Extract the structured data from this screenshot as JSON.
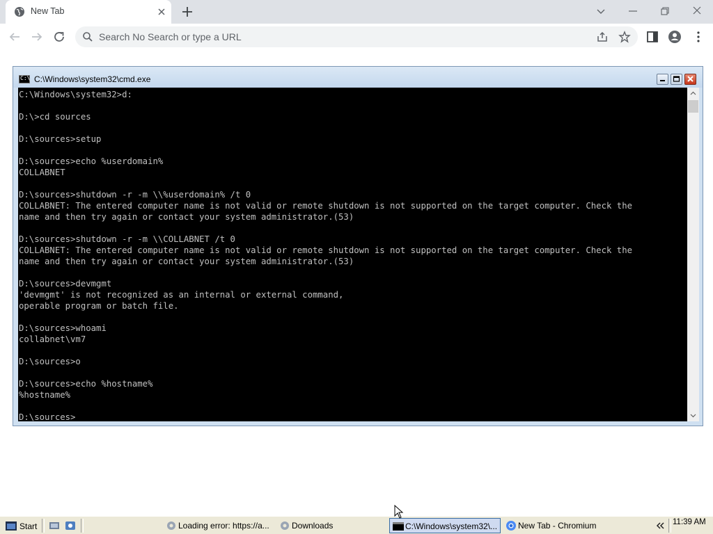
{
  "browser": {
    "tab": {
      "title": "New Tab"
    },
    "omnibox": {
      "placeholder": "Search No Search or type a URL"
    }
  },
  "cmd": {
    "title": "C:\\Windows\\system32\\cmd.exe",
    "lines": [
      "C:\\Windows\\system32>d:",
      "",
      "D:\\>cd sources",
      "",
      "D:\\sources>setup",
      "",
      "D:\\sources>echo %userdomain%",
      "COLLABNET",
      "",
      "D:\\sources>shutdown -r -m \\\\%userdomain% /t 0",
      "COLLABNET: The entered computer name is not valid or remote shutdown is not supported on the target computer. Check the",
      "name and then try again or contact your system administrator.(53)",
      "",
      "D:\\sources>shutdown -r -m \\\\COLLABNET /t 0",
      "COLLABNET: The entered computer name is not valid or remote shutdown is not supported on the target computer. Check the",
      "name and then try again or contact your system administrator.(53)",
      "",
      "D:\\sources>devmgmt",
      "'devmgmt' is not recognized as an internal or external command,",
      "operable program or batch file.",
      "",
      "D:\\sources>whoami",
      "collabnet\\vm7",
      "",
      "D:\\sources>o",
      "",
      "D:\\sources>echo %hostname%",
      "%hostname%",
      "",
      "D:\\sources>"
    ]
  },
  "taskbar": {
    "start_label": "Start",
    "tasks": [
      {
        "label": "Loading error: https://a..."
      },
      {
        "label": "Downloads"
      },
      {
        "label": "C:\\Windows\\system32\\..."
      },
      {
        "label": "New Tab - Chromium"
      }
    ],
    "clock": "11:39 AM"
  }
}
